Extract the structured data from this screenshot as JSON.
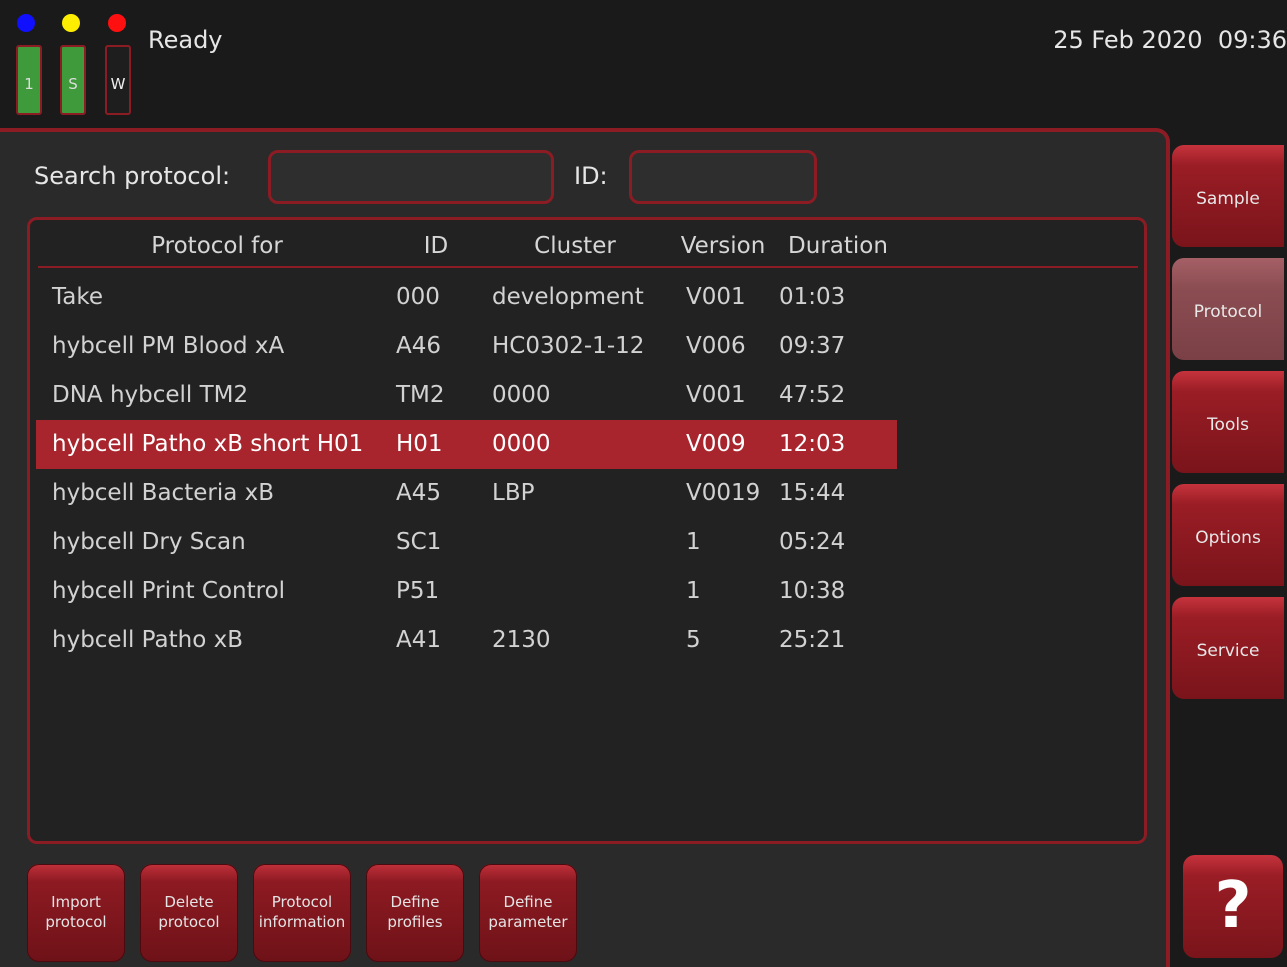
{
  "status": {
    "leds": [
      {
        "color": "#1010ff"
      },
      {
        "color": "#ffee00"
      },
      {
        "color": "#ff1010"
      }
    ],
    "slots": [
      {
        "label": "1",
        "state": "green"
      },
      {
        "label": "S",
        "state": "green"
      },
      {
        "label": "W",
        "state": "empty"
      }
    ],
    "text": "Ready",
    "datetime": "25 Feb 2020  09:36"
  },
  "search": {
    "label": "Search protocol:",
    "value": "",
    "id_label": "ID:",
    "id_value": ""
  },
  "table": {
    "columns": [
      "Protocol for",
      "ID",
      "Cluster",
      "Version",
      "Duration"
    ],
    "rows": [
      {
        "protocol": "Take",
        "id": "000",
        "cluster": "development",
        "version": "V001",
        "duration": "01:03"
      },
      {
        "protocol": "hybcell PM Blood xA",
        "id": "A46",
        "cluster": "HC0302-1-12",
        "version": "V006",
        "duration": "09:37"
      },
      {
        "protocol": "DNA hybcell TM2",
        "id": "TM2",
        "cluster": "0000",
        "version": "V001",
        "duration": "47:52"
      },
      {
        "protocol": "hybcell Patho xB short H01",
        "id": "H01",
        "cluster": "0000",
        "version": "V009",
        "duration": "12:03",
        "selected": true
      },
      {
        "protocol": "hybcell Bacteria xB",
        "id": "A45",
        "cluster": "LBP",
        "version": "V0019",
        "duration": "15:44"
      },
      {
        "protocol": "hybcell Dry Scan",
        "id": "SC1",
        "cluster": "",
        "version": "1",
        "duration": "05:24"
      },
      {
        "protocol": "hybcell Print Control",
        "id": "P51",
        "cluster": "",
        "version": "1",
        "duration": "10:38"
      },
      {
        "protocol": "hybcell Patho xB",
        "id": "A41",
        "cluster": "2130",
        "version": "5",
        "duration": "25:21"
      }
    ]
  },
  "actions": [
    {
      "line1": "Import",
      "line2": "protocol"
    },
    {
      "line1": "Delete",
      "line2": "protocol"
    },
    {
      "line1": "Protocol",
      "line2": "information"
    },
    {
      "line1": "Define",
      "line2": "profiles"
    },
    {
      "line1": "Define",
      "line2": "parameter"
    }
  ],
  "nav": {
    "tabs": [
      "Sample",
      "Protocol",
      "Tools",
      "Options",
      "Service"
    ],
    "active": "Protocol",
    "help_label": "?"
  },
  "colors": {
    "accent": "#8c1c24",
    "selection": "#a8252e",
    "slot_green": "#3e9a3a"
  }
}
